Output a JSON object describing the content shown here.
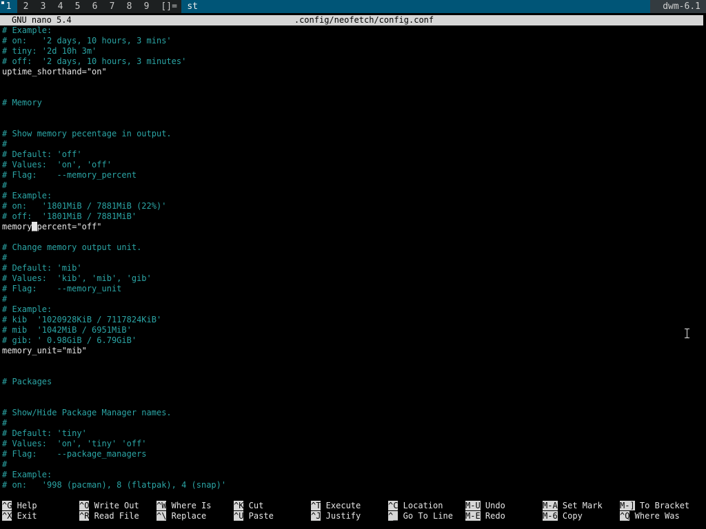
{
  "bar": {
    "tags": [
      "1",
      "2",
      "3",
      "4",
      "5",
      "6",
      "7",
      "8",
      "9"
    ],
    "active_tag": 0,
    "layout": "[]=",
    "window_title": "st",
    "status": "dwm-6.1"
  },
  "nano": {
    "version": "GNU nano 5.4",
    "filename": ".config/neofetch/config.conf"
  },
  "editor_lines": [
    {
      "text": "# Example:",
      "kind": "comment"
    },
    {
      "text": "# on:   '2 days, 10 hours, 3 mins'",
      "kind": "comment"
    },
    {
      "text": "# tiny: '2d 10h 3m'",
      "kind": "comment"
    },
    {
      "text": "# off:  '2 days, 10 hours, 3 minutes'",
      "kind": "comment"
    },
    {
      "text": "uptime_shorthand=\"on\"",
      "kind": "code"
    },
    {
      "text": "",
      "kind": "blank"
    },
    {
      "text": "",
      "kind": "blank"
    },
    {
      "text": "# Memory",
      "kind": "comment"
    },
    {
      "text": "",
      "kind": "blank"
    },
    {
      "text": "",
      "kind": "blank"
    },
    {
      "text": "# Show memory pecentage in output.",
      "kind": "comment"
    },
    {
      "text": "#",
      "kind": "comment"
    },
    {
      "text": "# Default: 'off'",
      "kind": "comment"
    },
    {
      "text": "# Values:  'on', 'off'",
      "kind": "comment"
    },
    {
      "text": "# Flag:    --memory_percent",
      "kind": "comment"
    },
    {
      "text": "#",
      "kind": "comment"
    },
    {
      "text": "# Example:",
      "kind": "comment"
    },
    {
      "text": "# on:   '1801MiB / 7881MiB (22%)'",
      "kind": "comment"
    },
    {
      "text": "# off:  '1801MiB / 7881MiB'",
      "kind": "comment"
    },
    {
      "text": "memory_percent=\"off\"",
      "kind": "code",
      "cursor_col": 6
    },
    {
      "text": "",
      "kind": "blank"
    },
    {
      "text": "# Change memory output unit.",
      "kind": "comment"
    },
    {
      "text": "#",
      "kind": "comment"
    },
    {
      "text": "# Default: 'mib'",
      "kind": "comment"
    },
    {
      "text": "# Values:  'kib', 'mib', 'gib'",
      "kind": "comment"
    },
    {
      "text": "# Flag:    --memory_unit",
      "kind": "comment"
    },
    {
      "text": "#",
      "kind": "comment"
    },
    {
      "text": "# Example:",
      "kind": "comment"
    },
    {
      "text": "# kib  '1020928KiB / 7117824KiB'",
      "kind": "comment"
    },
    {
      "text": "# mib  '1042MiB / 6951MiB'",
      "kind": "comment"
    },
    {
      "text": "# gib: ' 0.98GiB / 6.79GiB'",
      "kind": "comment"
    },
    {
      "text": "memory_unit=\"mib\"",
      "kind": "code"
    },
    {
      "text": "",
      "kind": "blank"
    },
    {
      "text": "",
      "kind": "blank"
    },
    {
      "text": "# Packages",
      "kind": "comment"
    },
    {
      "text": "",
      "kind": "blank"
    },
    {
      "text": "",
      "kind": "blank"
    },
    {
      "text": "# Show/Hide Package Manager names.",
      "kind": "comment"
    },
    {
      "text": "#",
      "kind": "comment"
    },
    {
      "text": "# Default: 'tiny'",
      "kind": "comment"
    },
    {
      "text": "# Values:  'on', 'tiny' 'off'",
      "kind": "comment"
    },
    {
      "text": "# Flag:    --package_managers",
      "kind": "comment"
    },
    {
      "text": "#",
      "kind": "comment"
    },
    {
      "text": "# Example:",
      "kind": "comment"
    },
    {
      "text": "# on:   '998 (pacman), 8 (flatpak), 4 (snap)'",
      "kind": "comment"
    }
  ],
  "shortcuts": {
    "row1": [
      {
        "key": "^G",
        "label": "Help"
      },
      {
        "key": "^O",
        "label": "Write Out"
      },
      {
        "key": "^W",
        "label": "Where Is"
      },
      {
        "key": "^K",
        "label": "Cut"
      },
      {
        "key": "^T",
        "label": "Execute"
      },
      {
        "key": "^C",
        "label": "Location"
      },
      {
        "key": "M-U",
        "label": "Undo"
      },
      {
        "key": "M-A",
        "label": "Set Mark"
      },
      {
        "key": "M-]",
        "label": "To Bracket"
      }
    ],
    "row2": [
      {
        "key": "^X",
        "label": "Exit"
      },
      {
        "key": "^R",
        "label": "Read File"
      },
      {
        "key": "^\\",
        "label": "Replace"
      },
      {
        "key": "^U",
        "label": "Paste"
      },
      {
        "key": "^J",
        "label": "Justify"
      },
      {
        "key": "^_",
        "label": "Go To Line"
      },
      {
        "key": "M-E",
        "label": "Redo"
      },
      {
        "key": "M-6",
        "label": "Copy"
      },
      {
        "key": "^Q",
        "label": "Where Was"
      }
    ]
  },
  "mouse_cursor_icon": "text-ibeam-icon",
  "colors": {
    "comment": "#2ba5a5",
    "code": "#e6e6e6",
    "bar_accent": "#005577",
    "title_bg": "#d6d6d6"
  }
}
